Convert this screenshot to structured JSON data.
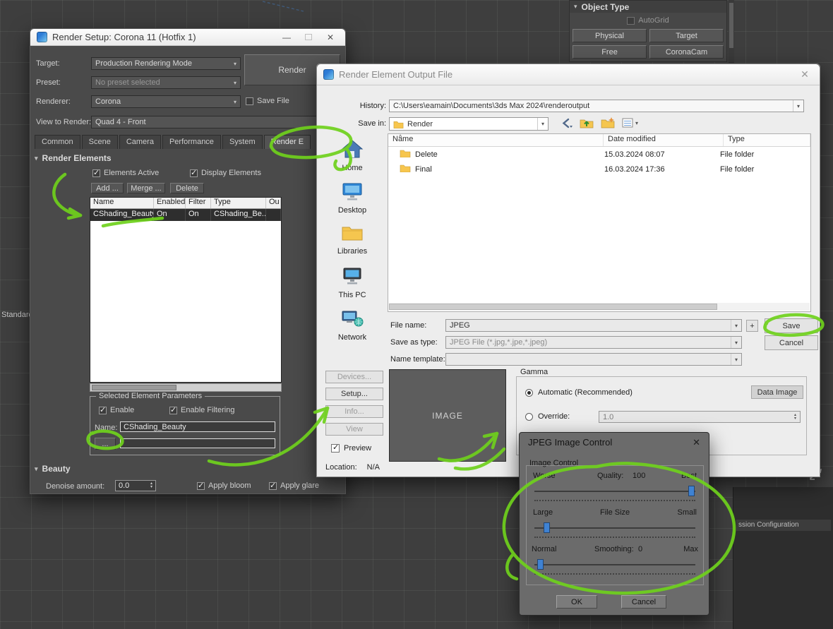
{
  "viewport": {
    "standard_label": "Standard",
    "session_config_label": "ssion Configuration"
  },
  "object_type": {
    "title": "Object Type",
    "autogrid_label": "AutoGrid",
    "buttons": [
      "Physical",
      "Target",
      "Free",
      "CoronaCam"
    ]
  },
  "render_setup": {
    "title": "Render Setup: Corona 11 (Hotfix 1)",
    "target_label": "Target:",
    "target_value": "Production Rendering Mode",
    "preset_label": "Preset:",
    "preset_value": "No preset selected",
    "renderer_label": "Renderer:",
    "renderer_value": "Corona",
    "save_file_label": "Save File",
    "view_label": "View to Render:",
    "view_value": "Quad 4 - Front",
    "render_button": "Render",
    "tabs": [
      "Common",
      "Scene",
      "Camera",
      "Performance",
      "System",
      "Render E"
    ],
    "render_elements": {
      "title": "Render Elements",
      "elements_active_label": "Elements Active",
      "display_elements_label": "Display Elements",
      "add_button": "Add ...",
      "merge_button": "Merge ...",
      "delete_button": "Delete",
      "columns": [
        "Name",
        "Enabled",
        "Filter",
        "Type",
        "Ou"
      ],
      "row": {
        "name": "CShading_Beauty",
        "enabled": "On",
        "filter": "On",
        "type": "CShading_Be..."
      },
      "group_title": "Selected Element Parameters",
      "enable_label": "Enable",
      "enable_filtering_label": "Enable Filtering",
      "name_label": "Name:",
      "name_value": "CShading_Beauty",
      "browse_button": "..."
    },
    "beauty": {
      "title": "Beauty",
      "denoise_label": "Denoise amount:",
      "denoise_value": "0.0",
      "apply_bloom_label": "Apply bloom",
      "apply_glare_label": "Apply glare"
    }
  },
  "output_dialog": {
    "title": "Render Element Output File",
    "history_label": "History:",
    "history_value": "C:\\Users\\eamain\\Documents\\3ds Max 2024\\renderoutput",
    "save_in_label": "Save in:",
    "save_in_value": "Render",
    "places": [
      "Home",
      "Desktop",
      "Libraries",
      "This PC",
      "Network"
    ],
    "columns": [
      "Name",
      "Date modified",
      "Type"
    ],
    "files": [
      {
        "name": "Delete",
        "date": "15.03.2024 08:07",
        "type": "File folder"
      },
      {
        "name": "Final",
        "date": "16.03.2024 17:36",
        "type": "File folder"
      }
    ],
    "file_name_label": "File name:",
    "file_name_value": "JPEG",
    "plus_button": "+",
    "save_button": "Save",
    "save_as_label": "Save as type:",
    "save_as_value": "JPEG File (*.jpg,*.jpe,*.jpeg)",
    "cancel_button": "Cancel",
    "template_label": "Name template:",
    "devices_button": "Devices...",
    "setup_button": "Setup...",
    "info_button": "Info...",
    "view_button": "View",
    "preview_label": "Preview",
    "location_label": "Location:",
    "location_value": "N/A",
    "image_placeholder": "IMAGE",
    "gamma": {
      "title": "Gamma",
      "automatic_label": "Automatic (Recommended)",
      "override_label": "Override:",
      "override_value": "1.0",
      "data_image_button": "Data Image"
    }
  },
  "jpeg_dialog": {
    "title": "JPEG Image Control",
    "group_title": "Image Control",
    "quality": {
      "left": "Worse",
      "label": "Quality:",
      "value": "100",
      "right": "Best",
      "percent": 98
    },
    "file_size": {
      "left": "Large",
      "label": "File Size",
      "right": "Small",
      "percent": 6
    },
    "smoothing": {
      "left": "Normal",
      "label": "Smoothing:",
      "value": "0",
      "right": "Max",
      "percent": 2
    },
    "ok_button": "OK",
    "cancel_button": "Cancel"
  },
  "colors": {
    "annotation_green": "#6fd11c",
    "slider_blue": "#3f82d2"
  }
}
